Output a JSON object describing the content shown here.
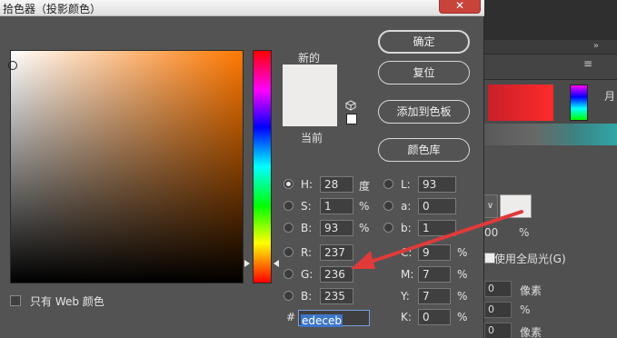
{
  "dialog": {
    "title": "拾色器（投影颜色）",
    "close_label": "✕",
    "new_label": "新的",
    "current_label": "当前",
    "new_color": "#edeceb",
    "current_color": "#edeceb",
    "hue_color": "#ff7800",
    "only_web_label": "只有 Web 颜色"
  },
  "buttons": {
    "ok": "确定",
    "reset": "复位",
    "add_to_swatches": "添加到色板",
    "color_libraries": "颜色库"
  },
  "fields": {
    "H": {
      "label": "H:",
      "value": "28",
      "unit": "度"
    },
    "S": {
      "label": "S:",
      "value": "1",
      "unit": "%"
    },
    "Bhsb": {
      "label": "B:",
      "value": "93",
      "unit": "%"
    },
    "R": {
      "label": "R:",
      "value": "237"
    },
    "G": {
      "label": "G:",
      "value": "236"
    },
    "Brgb": {
      "label": "B:",
      "value": "235"
    },
    "L": {
      "label": "L:",
      "value": "93"
    },
    "a": {
      "label": "a:",
      "value": "0"
    },
    "b": {
      "label": "b:",
      "value": "1"
    },
    "C": {
      "label": "C:",
      "value": "9",
      "unit": "%"
    },
    "M": {
      "label": "M:",
      "value": "7",
      "unit": "%"
    },
    "Y": {
      "label": "Y:",
      "value": "7",
      "unit": "%"
    },
    "K": {
      "label": "K:",
      "value": "0",
      "unit": "%"
    },
    "hex_label": "#",
    "hex": "edeceb"
  },
  "background_panel": {
    "menu_icon": "≡",
    "double_chevron": "»",
    "partial_char": "月",
    "opacity_value": "00",
    "opacity_unit": "%",
    "use_global_light": "使用全局光(G)",
    "field_unit_1": "像素",
    "field_unit_2": "%",
    "field_unit_3": "像素",
    "field_value_1": "0",
    "field_value_2": "0",
    "field_value_3": "0",
    "dropdown_glyph": "∨"
  },
  "annotation": {
    "arrow_color": "#e03a3a"
  }
}
